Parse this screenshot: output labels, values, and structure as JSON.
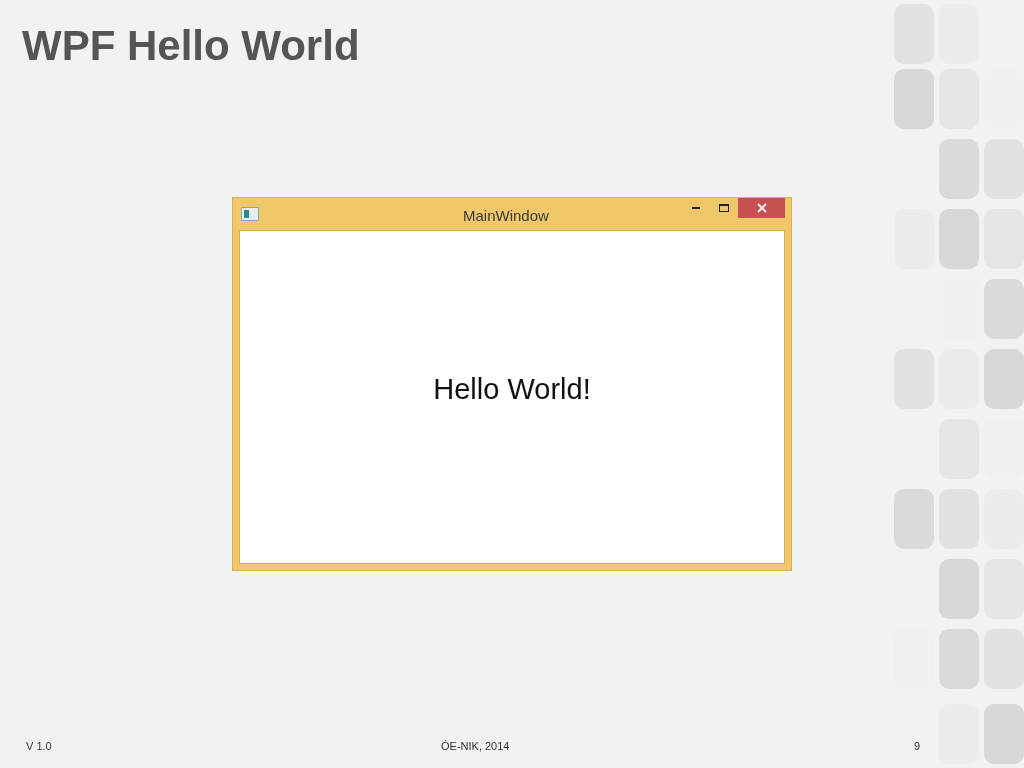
{
  "slide": {
    "title": "WPF Hello World"
  },
  "window": {
    "title": "MainWindow",
    "content": "Hello World!"
  },
  "footer": {
    "version": "V 1.0",
    "credit": "ÓE-NIK, 2014",
    "page": "9"
  }
}
